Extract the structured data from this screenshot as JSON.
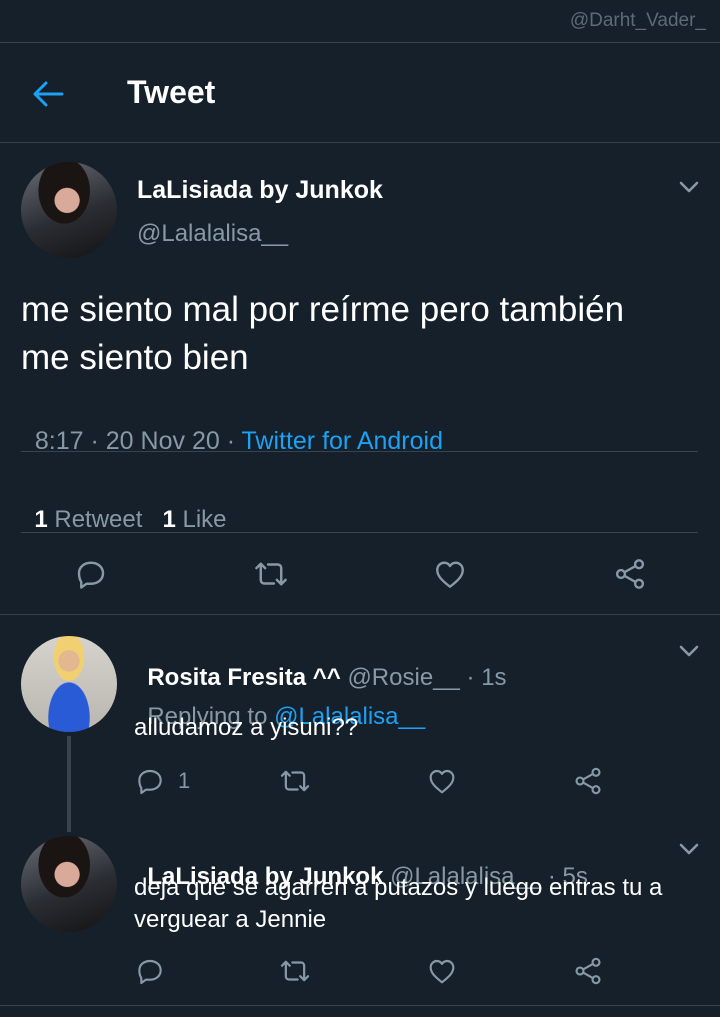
{
  "watermark": "@Darht_Vader_",
  "header": {
    "title": "Tweet"
  },
  "tweet": {
    "author_name": "LaLisiada by Junkok",
    "author_handle": "@Lalalalisa__",
    "text_line1": "me siento mal por reírme pero también",
    "text_line2": "me siento bien",
    "time_date": "8:17 · 20 Nov 20 · ",
    "source": "Twitter for Android",
    "stats": {
      "retweet_count": "1",
      "retweet_label": "Retweet",
      "like_count": "1",
      "like_label": "Like"
    }
  },
  "replies": [
    {
      "author_name": "Rosita Fresita ^^",
      "author_handle": "@Rosie__",
      "time": " · 1s",
      "replying_prefix": "Replying to ",
      "replying_handle": "@Lalalalisa__",
      "text": "alludamoz a yisuni??",
      "reply_count": "1"
    },
    {
      "author_name": "LaLisiada by Junkok",
      "author_handle": "@Lalalalisa__",
      "time": " · 5s",
      "text_line1": "deja que se agarren a putazos y luego entras tu a",
      "text_line2": "verguear a Jennie"
    }
  ],
  "colors": {
    "background": "#15202b",
    "accent": "#1da1f2",
    "muted": "#8899a6",
    "divider": "#38444d"
  },
  "icons": [
    "back-arrow-icon",
    "chevron-down-icon",
    "reply-icon",
    "retweet-icon",
    "like-icon",
    "share-icon"
  ]
}
